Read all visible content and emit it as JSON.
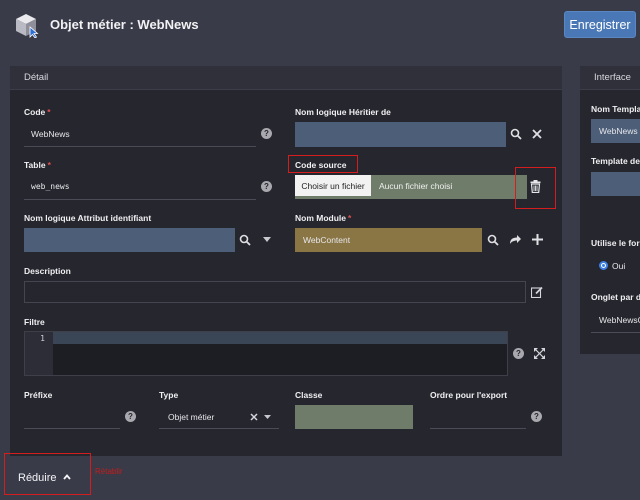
{
  "header": {
    "title": "Objet métier : WebNews",
    "save_label": "Enregistrer"
  },
  "detail": {
    "header": "Détail",
    "code": {
      "label": "Code",
      "required_mark": "*",
      "value": "WebNews"
    },
    "heritier": {
      "label": "Nom logique Héritier de",
      "value": ""
    },
    "table": {
      "label": "Table",
      "required_mark": "*",
      "value": "web_news"
    },
    "code_source": {
      "label": "Code source",
      "file_button": "Choisir un fichier",
      "file_status": "Aucun fichier choisi"
    },
    "attribut": {
      "label": "Nom logique Attribut identifiant",
      "value": ""
    },
    "module": {
      "label": "Nom Module",
      "required_mark": "*",
      "value": "WebContent"
    },
    "description": {
      "label": "Description",
      "value": ""
    },
    "filtre": {
      "label": "Filtre",
      "line_number": "1"
    },
    "prefixe": {
      "label": "Préfixe",
      "value": ""
    },
    "type": {
      "label": "Type",
      "value": "Objet métier"
    },
    "classe": {
      "label": "Classe",
      "value": ""
    },
    "ordre": {
      "label": "Ordre pour l'export",
      "value": ""
    }
  },
  "interface": {
    "header": "Interface",
    "nom_template": {
      "label": "Nom Templa",
      "value": "WebNews"
    },
    "template": {
      "label": "Template de"
    },
    "utilise": {
      "label": "Utilise le for",
      "option": "Oui"
    },
    "onglet": {
      "label": "Onglet par d",
      "value": "WebNewsC"
    }
  },
  "footer": {
    "reduce_label": "Réduire",
    "annotation": "Rétablir"
  },
  "colors": {
    "background": "#3a3b48",
    "panel": "#26262f",
    "accent": "#4a78b6",
    "field_blue": "#4c5e78",
    "field_gold": "#8a7545",
    "highlight_red": "#d41e1e"
  }
}
